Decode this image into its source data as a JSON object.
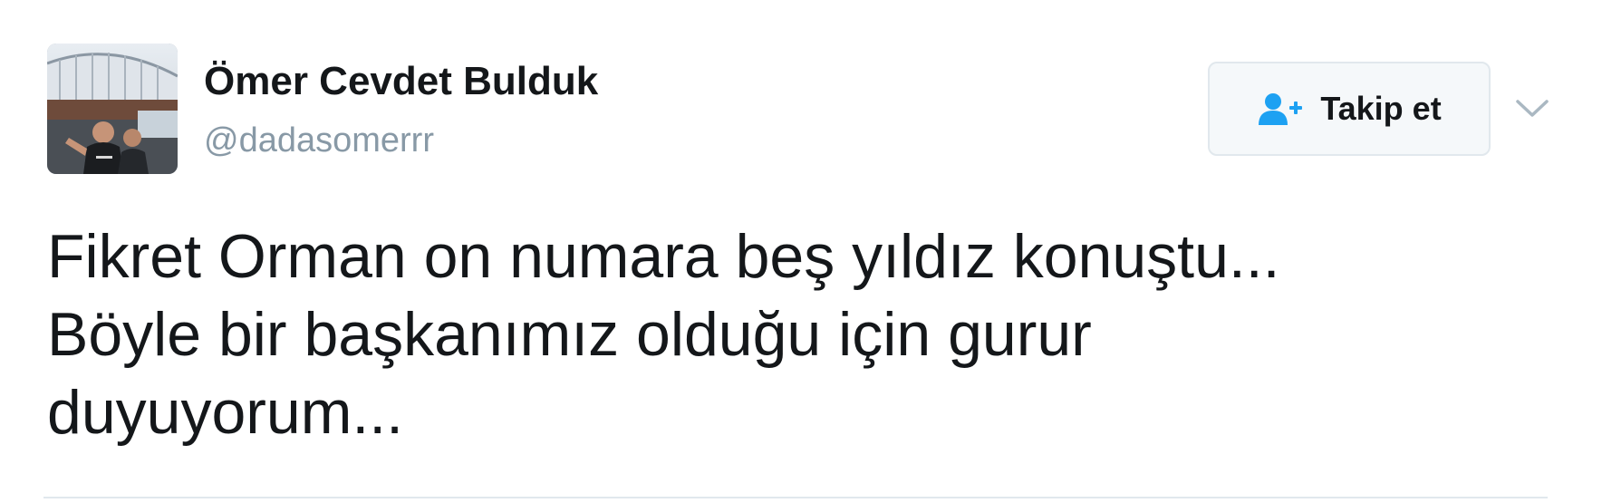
{
  "tweet": {
    "author": {
      "name": "Ömer Cevdet Bulduk",
      "handle": "@dadasomerrr"
    },
    "follow_button": {
      "label": "Takip et",
      "icon": "follow-user-icon"
    },
    "more_icon": "chevron-down-icon",
    "text_lines": [
      "Fikret Orman on numara beş yıldız konuştu...",
      "Böyle bir başkanımız olduğu için gurur",
      "duyuyorum..."
    ],
    "colors": {
      "accent": "#1da1f2",
      "handle": "#8899a6",
      "text": "#14171a",
      "button_bg": "#f5f8fa",
      "border": "#e1e8ed"
    }
  }
}
